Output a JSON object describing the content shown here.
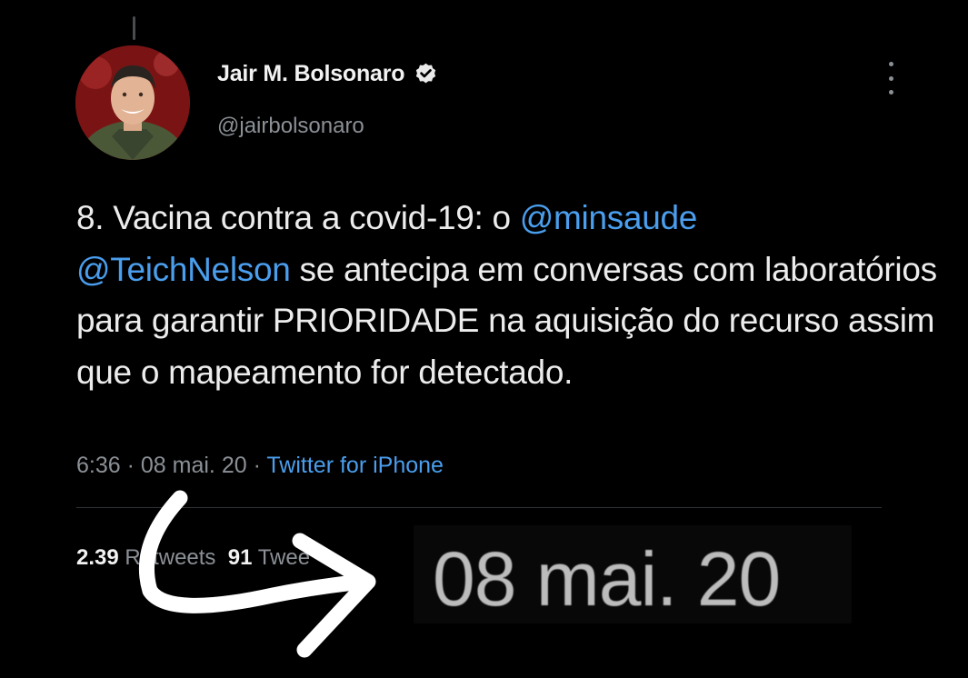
{
  "tweet": {
    "author": {
      "display_name": "Jair M. Bolsonaro",
      "handle": "@jairbolsonaro",
      "verified_icon": "verified-badge-icon"
    },
    "text_parts": {
      "prefix": "8. Vacina contra a covid-19: o ",
      "mention_1": "@minsaude",
      "mention_2": "@TeichNelson",
      "suffix": " se antecipa em conversas com laboratórios para garantir PRIORIDADE na aquisição do recurso assim que o mapeamento for detectado."
    },
    "meta": {
      "time": "6:36",
      "separator": " · ",
      "date": "08 mai. 20",
      "source": "Twitter for iPhone"
    },
    "stats": {
      "retweets_count": "2.39",
      "retweets_label": "Retweets",
      "quotes_count": "91",
      "quotes_label": "Twee"
    }
  },
  "overlay": {
    "zoomed_date": "08 mai. 20",
    "arrow_icon": "curved-arrow-icon"
  },
  "colors": {
    "background": "#000000",
    "link": "#4a9eed",
    "secondary_text": "#8b9096",
    "primary_text": "#ececec"
  }
}
